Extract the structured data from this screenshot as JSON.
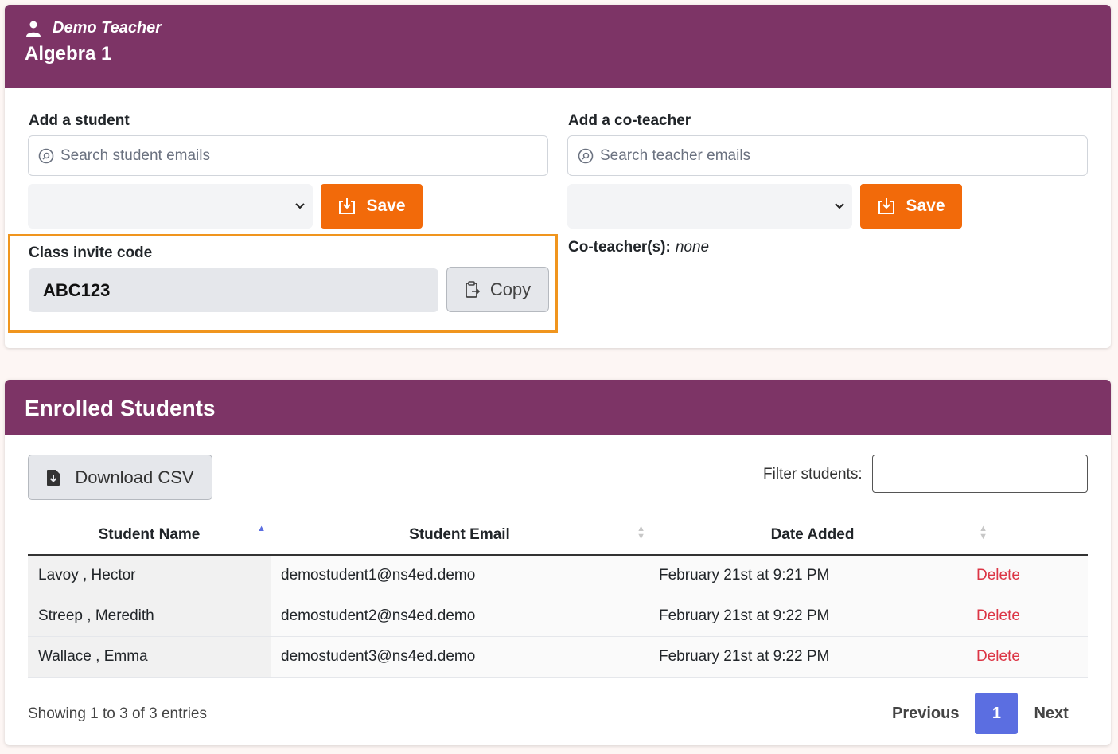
{
  "header": {
    "teacher_name": "Demo Teacher",
    "class_name": "Algebra 1"
  },
  "add_student": {
    "label": "Add a student",
    "search_placeholder": "Search student emails",
    "save_label": "Save"
  },
  "add_coteacher": {
    "label": "Add a co-teacher",
    "search_placeholder": "Search teacher emails",
    "save_label": "Save"
  },
  "invite": {
    "label": "Class invite code",
    "code": "ABC123",
    "copy_label": "Copy"
  },
  "coteachers": {
    "label": "Co-teacher(s):",
    "value": "none"
  },
  "enrolled": {
    "title": "Enrolled Students",
    "download_label": "Download CSV",
    "filter_label": "Filter students:",
    "columns": [
      "Student Name",
      "Student Email",
      "Date Added"
    ],
    "rows": [
      {
        "name": "Lavoy , Hector",
        "email": "demostudent1@ns4ed.demo",
        "date": "February 21st at 9:21 PM",
        "action": "Delete"
      },
      {
        "name": "Streep , Meredith",
        "email": "demostudent2@ns4ed.demo",
        "date": "February 21st at 9:22 PM",
        "action": "Delete"
      },
      {
        "name": "Wallace , Emma",
        "email": "demostudent3@ns4ed.demo",
        "date": "February 21st at 9:22 PM",
        "action": "Delete"
      }
    ],
    "showing": "Showing 1 to 3 of 3 entries",
    "pagination": {
      "previous": "Previous",
      "current": "1",
      "next": "Next"
    }
  },
  "colors": {
    "header_bg": "#7d3466",
    "save_button": "#f26a0a",
    "highlight_border": "#f0951e",
    "delete_link": "#dc3545",
    "active_page": "#5b6ee1"
  },
  "icons": {
    "teacher": "user-icon",
    "search": "search-icon",
    "save": "save-download-icon",
    "copy": "clipboard-icon",
    "csv": "file-download-icon",
    "sort_asc": "sort-up-icon",
    "sort": "sort-icon"
  }
}
